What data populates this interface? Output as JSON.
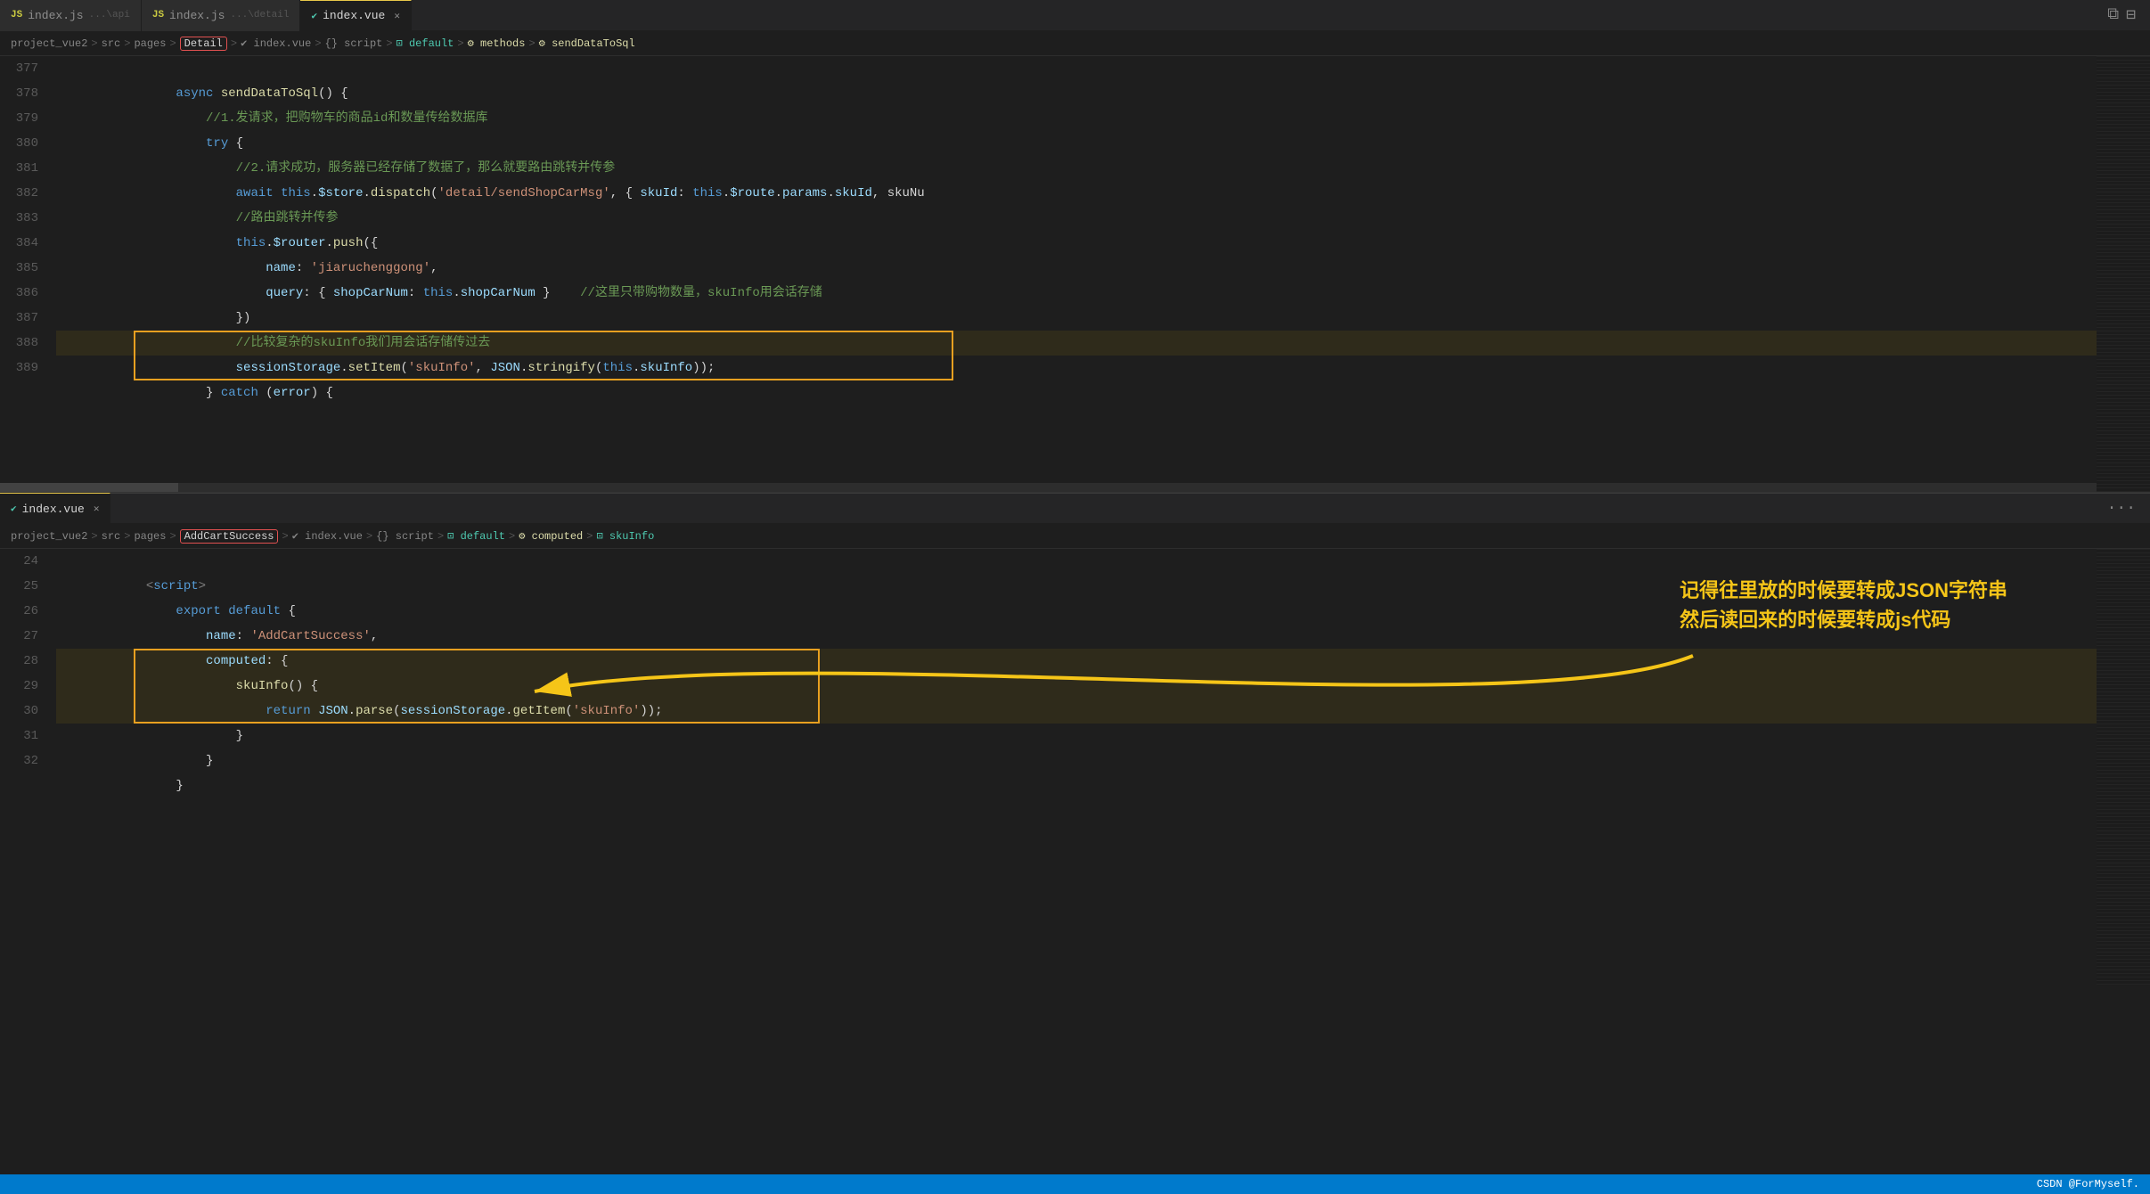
{
  "editor": {
    "tabs": [
      {
        "label": "index.js",
        "path": "...\\api",
        "icon": "js",
        "active": false
      },
      {
        "label": "index.js",
        "path": "...\\detail",
        "icon": "js",
        "active": false
      },
      {
        "label": "index.vue",
        "path": "",
        "icon": "vue",
        "active": true,
        "closable": true
      }
    ],
    "window_icons": [
      "⚡",
      "⊟"
    ]
  },
  "top_pane": {
    "breadcrumb": [
      "project_vue2",
      ">",
      "src",
      ">",
      "pages",
      ">",
      "Detail",
      ">",
      "index.vue",
      ">",
      "{} script",
      ">",
      "⊡ default",
      ">",
      "⚙ methods",
      ">",
      "⚙ sendDataToSql"
    ],
    "breadcrumb_highlighted": "Detail",
    "lines": [
      {
        "num": 377,
        "code": "        async sendDataToSql() {"
      },
      {
        "num": 378,
        "code": "            //1.发请求，把购物车的商品id和数量传给数据库"
      },
      {
        "num": 379,
        "code": "            try {"
      },
      {
        "num": 380,
        "code": "                //2.请求成功，服务器已经存储了数据了，那么就要路由跳转并传参"
      },
      {
        "num": 381,
        "code": "                await this.$store.dispatch('detail/sendShopCarMsg', { skuId: this.$route.params.skuId, skuNu"
      },
      {
        "num": 382,
        "code": "                //路由跳转并传参"
      },
      {
        "num": 383,
        "code": "                this.$router.push({"
      },
      {
        "num": 384,
        "code": "                    name: 'jiaruchenggong',"
      },
      {
        "num": 385,
        "code": "                    query: { shopCarNum: this.shopCarNum }    //这里只带购物数量，skuInfo用会话存储"
      },
      {
        "num": 386,
        "code": "                })"
      },
      {
        "num": 387,
        "code": "                //比较复杂的skuInfo我们用会话存储传过去"
      },
      {
        "num": 388,
        "code": "                sessionStorage.setItem('skuInfo', JSON.stringify(this.skuInfo));"
      },
      {
        "num": 389,
        "code": "            } catch (error) {"
      }
    ]
  },
  "bottom_pane": {
    "tab_label": "index.vue",
    "breadcrumb": [
      "project_vue2",
      ">",
      "src",
      ">",
      "pages",
      ">",
      "AddCartSuccess",
      ">",
      "index.vue",
      ">",
      "{} script",
      ">",
      "⊡ default",
      ">",
      "⚙ computed",
      ">",
      "⊡ skuInfo"
    ],
    "breadcrumb_highlighted": "AddCartSuccess",
    "lines": [
      {
        "num": 24,
        "code": "    <script>"
      },
      {
        "num": 25,
        "code": "        export default {"
      },
      {
        "num": 26,
        "code": "            name: 'AddCartSuccess',"
      },
      {
        "num": 27,
        "code": "            computed: {"
      },
      {
        "num": 28,
        "code": "                skuInfo() {"
      },
      {
        "num": 29,
        "code": "                    return JSON.parse(sessionStorage.getItem('skuInfo'));"
      },
      {
        "num": 30,
        "code": "                }"
      },
      {
        "num": 31,
        "code": "            }"
      },
      {
        "num": 32,
        "code": "        }"
      }
    ]
  },
  "annotation": {
    "text": "记得往里放的时候要转成JSON字符串\n然后读回来的时候要转成js代码",
    "arrow_from": "annotation",
    "arrow_to": "highlight_box_bottom"
  },
  "status_bar": {
    "right_text": "CSDN @ForMyself."
  }
}
